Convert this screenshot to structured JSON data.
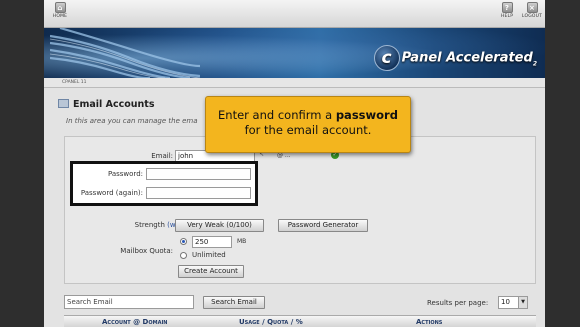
{
  "topbar": {
    "home_label": "HOME",
    "help_label": "HELP",
    "logout_label": "LOGOUT"
  },
  "banner": {
    "logo_letter": "c",
    "logo_text": "Panel Accelerated",
    "logo_version": "2"
  },
  "breadcrumb": "CPANEL 11",
  "page": {
    "title": "Email Accounts",
    "intro": "In this area you can manage the ema"
  },
  "form": {
    "email_label": "Email:",
    "email_value": "john",
    "domain_value": "@ ...",
    "password_label": "Password:",
    "password_again_label": "Password (again):",
    "strength_label": "Strength",
    "strength_why": "(why?)",
    "strength_colon": ":",
    "strength_value": "Very Weak (0/100)",
    "password_generator_label": "Password Generator",
    "quota_label": "Mailbox Quota:",
    "quota_value": "250",
    "quota_unit": "MB",
    "unlimited_label": "Unlimited",
    "create_account_label": "Create Account"
  },
  "tooltip": {
    "line1_prefix": "Enter and confirm a ",
    "line1_bold": "password",
    "line2": "for the email account."
  },
  "search": {
    "placeholder": "Search Email",
    "button_label": "Search Email",
    "results_label": "Results per page:",
    "results_value": "10"
  },
  "table": {
    "columns": [
      "Account @ Domain",
      "Usage / Quota / %",
      "Actions"
    ]
  },
  "colors": {
    "callout_bg": "#f3b51e",
    "banner_blue": "#1f4f86",
    "link_blue": "#223a66"
  }
}
